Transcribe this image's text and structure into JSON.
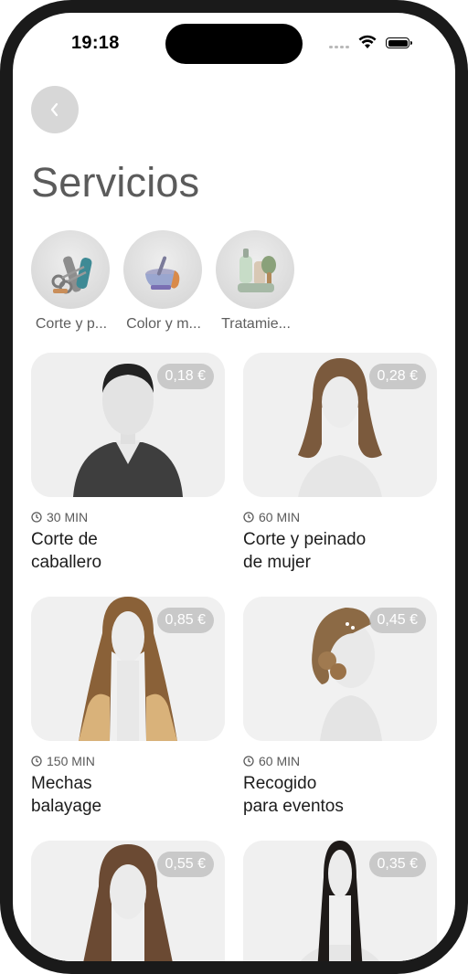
{
  "status_bar": {
    "time": "19:18"
  },
  "header": {
    "title": "Servicios"
  },
  "categories": [
    {
      "label": "Corte y p...",
      "icon": "scissors-comb-icon"
    },
    {
      "label": "Color y m...",
      "icon": "dye-bowl-icon"
    },
    {
      "label": "Tratamie...",
      "icon": "hair-products-icon"
    }
  ],
  "services": [
    {
      "price": "0,18 €",
      "duration": "30 MIN",
      "name": "Corte de\ncaballero"
    },
    {
      "price": "0,28 €",
      "duration": "60 MIN",
      "name": "Corte y peinado\nde mujer"
    },
    {
      "price": "0,85 €",
      "duration": "150 MIN",
      "name": "Mechas\nbalayage"
    },
    {
      "price": "0,45 €",
      "duration": "60 MIN",
      "name": "Recogido\npara eventos"
    },
    {
      "price": "0,55 €",
      "duration": "",
      "name": ""
    },
    {
      "price": "0,35 €",
      "duration": "",
      "name": ""
    }
  ]
}
